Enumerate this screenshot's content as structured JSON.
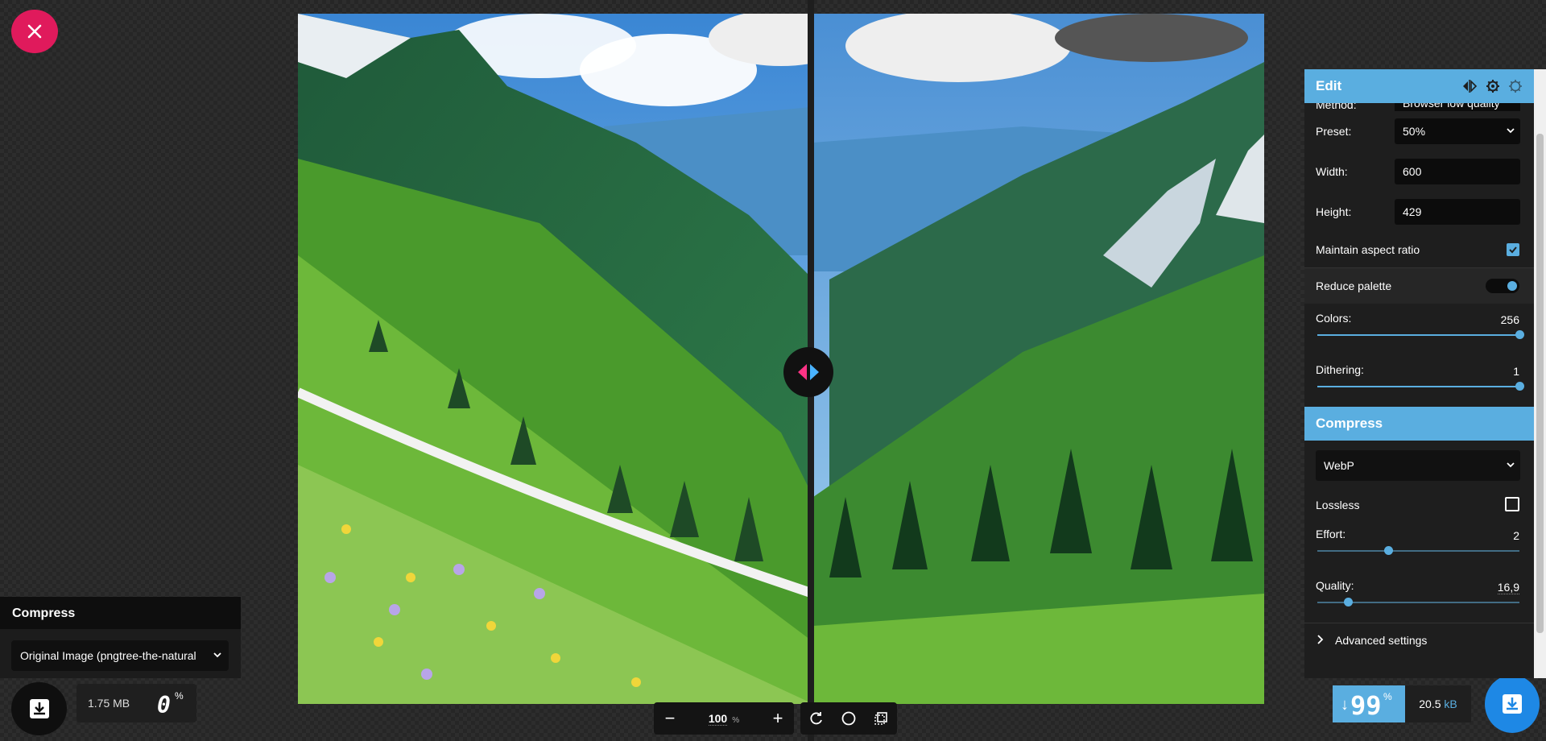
{
  "compress_left": {
    "header": "Compress",
    "selected_option": "Original Image (pngtree-the-natural",
    "file_size": "1.75 MB",
    "percent": "0",
    "percent_sign": "%"
  },
  "toolbar": {
    "zoom_value": "100",
    "zoom_unit": "%",
    "zoom_out": "−",
    "zoom_in": "+"
  },
  "edit_panel": {
    "title": "Edit",
    "method_label": "Method:",
    "method_value": "Browser low quality",
    "preset_label": "Preset:",
    "preset_value": "50%",
    "width_label": "Width:",
    "width_value": "600",
    "height_label": "Height:",
    "height_value": "429",
    "aspect_label": "Maintain aspect ratio",
    "aspect_checked": true,
    "palette_label": "Reduce palette",
    "palette_on": true,
    "colors_label": "Colors:",
    "colors_value": "256",
    "colors_fraction": 1.0,
    "dithering_label": "Dithering:",
    "dithering_value": "1",
    "dithering_fraction": 1.0
  },
  "compress_panel": {
    "title": "Compress",
    "codec": "WebP",
    "lossless_label": "Lossless",
    "lossless_checked": false,
    "effort_label": "Effort:",
    "effort_value": "2",
    "effort_fraction": 0.35,
    "quality_label": "Quality:",
    "quality_value": "16,9",
    "quality_fraction": 0.15,
    "advanced_label": "Advanced settings"
  },
  "result": {
    "arrow": "↓",
    "saving": "99",
    "saving_sign": "%",
    "out_size_num": "20.5",
    "out_size_unit": "kB"
  },
  "colors": {
    "accent": "#5aaee0",
    "close": "#e01a5c",
    "download_right": "#1e88e5"
  }
}
